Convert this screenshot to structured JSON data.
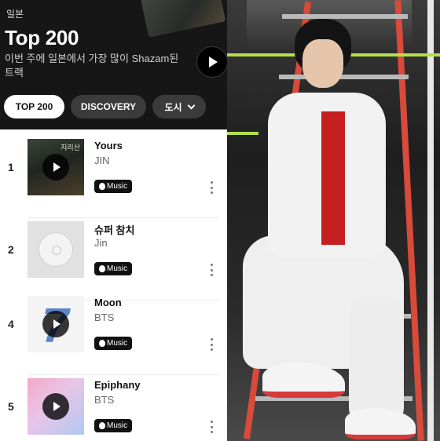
{
  "header": {
    "country": "일본",
    "title": "Top 200",
    "subtitle": "이번 주에 일본에서 가장 많이 Shazam된 트랙"
  },
  "filters": [
    {
      "label": "TOP 200",
      "selected": true
    },
    {
      "label": "DISCOVERY",
      "selected": false
    },
    {
      "label": "도시",
      "selected": false
    }
  ],
  "tracks": [
    {
      "rank": "1",
      "title": "Yours",
      "artist": "JIN",
      "service": "Music",
      "art_text": "지리산"
    },
    {
      "rank": "2",
      "title": "슈퍼 참치",
      "artist": "Jin",
      "service": "Music"
    },
    {
      "rank": "4",
      "title": "Moon",
      "artist": "BTS",
      "service": "Music"
    },
    {
      "rank": "5",
      "title": "Epiphany",
      "artist": "BTS",
      "service": "Music"
    }
  ],
  "colors": {
    "header_bg": "#161616",
    "chip_selected_bg": "#ffffff",
    "chip_bg": "#3b3b3b",
    "badge_bg": "#111111",
    "rail_red": "#d84a3a",
    "accent_green": "#b5e04a"
  },
  "icons": [
    "play-icon",
    "chevron-down-icon",
    "apple-logo-icon",
    "more-vertical-icon"
  ]
}
